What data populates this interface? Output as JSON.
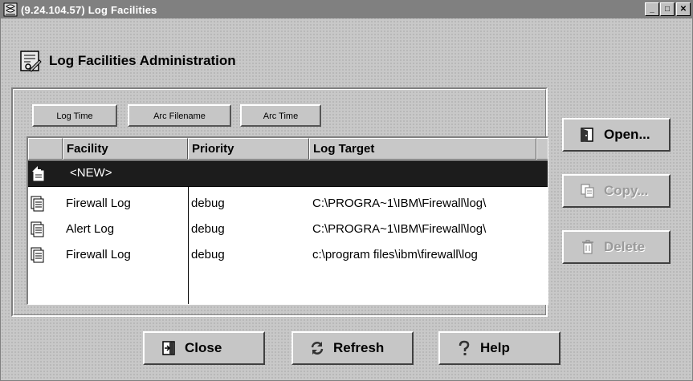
{
  "window": {
    "title": "(9.24.104.57) Log Facilities",
    "minimize_label": "_",
    "maximize_label": "□",
    "close_label": "✕"
  },
  "header": {
    "title": "Log Facilities Administration"
  },
  "sort_buttons": {
    "log_time": "Log Time",
    "arc_filename": "Arc Filename",
    "arc_time": "Arc Time"
  },
  "table": {
    "columns": [
      "Facility",
      "Priority",
      "Log Target"
    ],
    "new_row_label": "<NEW>",
    "rows": [
      {
        "facility": "Firewall Log",
        "priority": "debug",
        "log_target": "C:\\PROGRA~1\\IBM\\Firewall\\log\\"
      },
      {
        "facility": "Alert Log",
        "priority": "debug",
        "log_target": "C:\\PROGRA~1\\IBM\\Firewall\\log\\"
      },
      {
        "facility": "Firewall Log",
        "priority": "debug",
        "log_target": "c:\\program files\\ibm\\firewall\\log"
      }
    ]
  },
  "side_buttons": {
    "open": "Open...",
    "copy": "Copy...",
    "delete": "Delete"
  },
  "bottom_buttons": {
    "close": "Close",
    "refresh": "Refresh",
    "help": "Help"
  },
  "colors": {
    "title_bar": "#808080",
    "new_row_bg": "#1c1c1c",
    "face": "#c6c6c6",
    "disabled_text": "#9a9a9a"
  }
}
